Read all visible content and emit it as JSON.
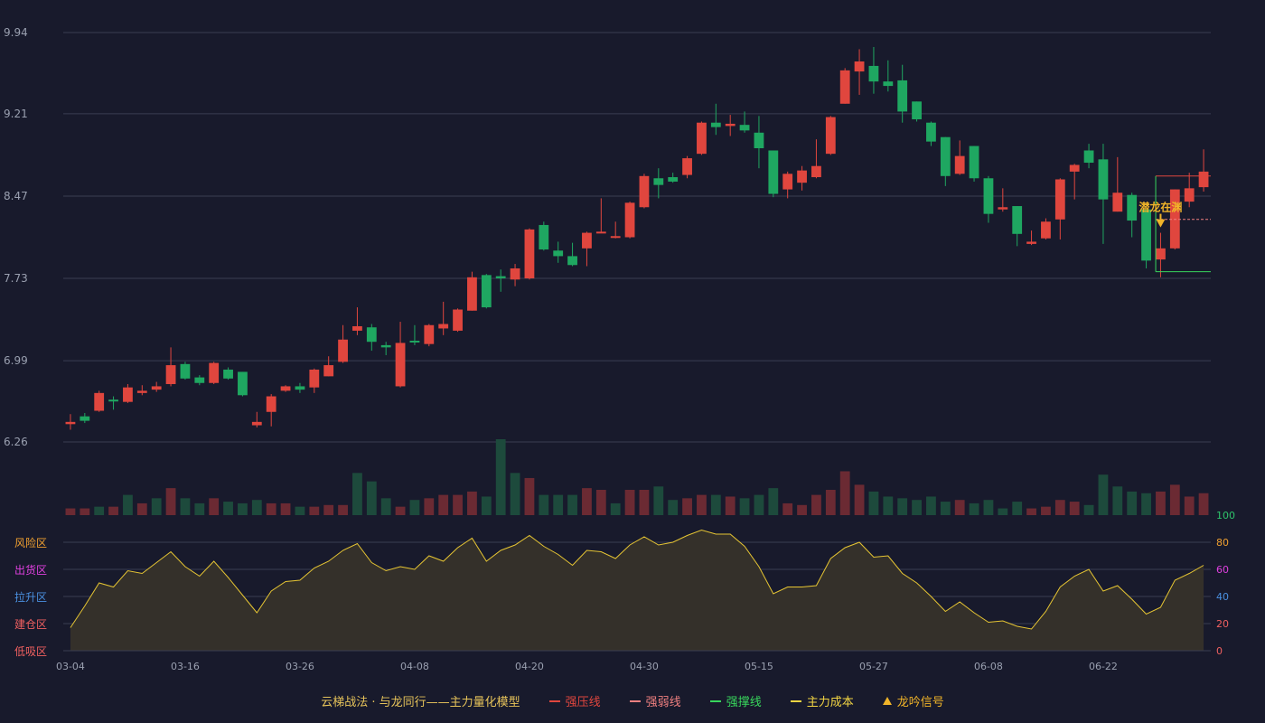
{
  "colors": {
    "background": "#181a2c",
    "up": "#e0463e",
    "down": "#1fa761",
    "vol_up": "#6b2a33",
    "vol_down": "#1d4a3c",
    "grid": "#3a3d52",
    "axis_text": "#9aa0b0",
    "osc_line": "#e6c533",
    "osc_fill": "#34302a",
    "pressure": "#e0463e",
    "weak": "#f08080",
    "support": "#38d65c",
    "cost": "#f1d443",
    "signal": "#f0b429"
  },
  "chart_data": {
    "type": "candlestick",
    "price_axis": {
      "ticks": [
        "9.94",
        "9.21",
        "8.47",
        "7.73",
        "6.99",
        "6.26"
      ],
      "range": [
        6.26,
        9.94
      ]
    },
    "x_axis": {
      "labels": [
        "03-04",
        "03-16",
        "03-26",
        "04-08",
        "04-20",
        "04-30",
        "05-15",
        "05-27",
        "06-08",
        "06-22"
      ],
      "label_indices": [
        0,
        8,
        16,
        24,
        32,
        40,
        48,
        56,
        64,
        72
      ]
    },
    "candles": [
      [
        6.42,
        6.44,
        6.51,
        6.37
      ],
      [
        6.49,
        6.45,
        6.52,
        6.43
      ],
      [
        6.54,
        6.7,
        6.72,
        6.53
      ],
      [
        6.64,
        6.63,
        6.67,
        6.55
      ],
      [
        6.62,
        6.75,
        6.78,
        6.61
      ],
      [
        6.7,
        6.72,
        6.77,
        6.68
      ],
      [
        6.73,
        6.76,
        6.8,
        6.71
      ],
      [
        6.78,
        6.95,
        7.11,
        6.76
      ],
      [
        6.96,
        6.83,
        6.98,
        6.82
      ],
      [
        6.84,
        6.79,
        6.86,
        6.77
      ],
      [
        6.79,
        6.97,
        6.98,
        6.78
      ],
      [
        6.91,
        6.83,
        6.93,
        6.82
      ],
      [
        6.89,
        6.68,
        6.89,
        6.67
      ],
      [
        6.41,
        6.44,
        6.53,
        6.39
      ],
      [
        6.53,
        6.67,
        6.69,
        6.4
      ],
      [
        6.72,
        6.76,
        6.77,
        6.71
      ],
      [
        6.76,
        6.73,
        6.79,
        6.7
      ],
      [
        6.75,
        6.91,
        6.92,
        6.7
      ],
      [
        6.85,
        6.95,
        7.03,
        6.85
      ],
      [
        6.98,
        7.18,
        7.31,
        6.97
      ],
      [
        7.26,
        7.3,
        7.47,
        7.22
      ],
      [
        7.29,
        7.16,
        7.32,
        7.08
      ],
      [
        7.13,
        7.11,
        7.16,
        7.04
      ],
      [
        6.76,
        7.15,
        7.34,
        6.75
      ],
      [
        7.17,
        7.16,
        7.31,
        7.13
      ],
      [
        7.14,
        7.31,
        7.32,
        7.12
      ],
      [
        7.28,
        7.32,
        7.52,
        7.22
      ],
      [
        7.26,
        7.45,
        7.46,
        7.25
      ],
      [
        7.44,
        7.74,
        7.79,
        7.44
      ],
      [
        7.76,
        7.47,
        7.77,
        7.46
      ],
      [
        7.75,
        7.73,
        7.81,
        7.61
      ],
      [
        7.72,
        7.82,
        7.86,
        7.66
      ],
      [
        7.73,
        8.17,
        8.18,
        7.72
      ],
      [
        8.21,
        7.99,
        8.24,
        7.98
      ],
      [
        7.98,
        7.93,
        8.06,
        7.87
      ],
      [
        7.93,
        7.85,
        8.05,
        7.84
      ],
      [
        8.0,
        8.14,
        8.15,
        7.84
      ],
      [
        8.15,
        8.15,
        8.45,
        8.14
      ],
      [
        8.11,
        8.11,
        8.24,
        8.09
      ],
      [
        8.1,
        8.41,
        8.42,
        8.09
      ],
      [
        8.37,
        8.65,
        8.67,
        8.36
      ],
      [
        8.63,
        8.57,
        8.72,
        8.45
      ],
      [
        8.64,
        8.6,
        8.68,
        8.59
      ],
      [
        8.66,
        8.81,
        8.83,
        8.63
      ],
      [
        8.85,
        9.13,
        9.14,
        8.84
      ],
      [
        9.13,
        9.09,
        9.3,
        9.02
      ],
      [
        9.1,
        9.12,
        9.2,
        9.01
      ],
      [
        9.11,
        9.06,
        9.23,
        9.04
      ],
      [
        9.04,
        8.9,
        9.19,
        8.72
      ],
      [
        8.88,
        8.49,
        8.88,
        8.46
      ],
      [
        8.53,
        8.67,
        8.69,
        8.45
      ],
      [
        8.59,
        8.7,
        8.74,
        8.52
      ],
      [
        8.64,
        8.74,
        8.98,
        8.63
      ],
      [
        8.85,
        9.18,
        9.19,
        8.84
      ],
      [
        9.3,
        9.6,
        9.62,
        9.3
      ],
      [
        9.59,
        9.68,
        9.79,
        9.38
      ],
      [
        9.64,
        9.5,
        9.81,
        9.39
      ],
      [
        9.5,
        9.46,
        9.69,
        9.41
      ],
      [
        9.51,
        9.23,
        9.65,
        9.13
      ],
      [
        9.32,
        9.16,
        9.32,
        9.14
      ],
      [
        9.13,
        8.96,
        9.14,
        8.92
      ],
      [
        9.0,
        8.65,
        9.0,
        8.56
      ],
      [
        8.67,
        8.83,
        8.97,
        8.66
      ],
      [
        8.92,
        8.63,
        8.92,
        8.6
      ],
      [
        8.63,
        8.31,
        8.65,
        8.23
      ],
      [
        8.35,
        8.37,
        8.54,
        8.33
      ],
      [
        8.38,
        8.13,
        8.38,
        8.02
      ],
      [
        8.04,
        8.06,
        8.16,
        8.03
      ],
      [
        8.09,
        8.24,
        8.27,
        8.08
      ],
      [
        8.26,
        8.62,
        8.63,
        8.08
      ],
      [
        8.69,
        8.75,
        8.76,
        8.44
      ],
      [
        8.88,
        8.77,
        8.94,
        8.72
      ],
      [
        8.8,
        8.44,
        8.94,
        8.04
      ],
      [
        8.33,
        8.5,
        8.82,
        8.33
      ],
      [
        8.48,
        8.25,
        8.5,
        8.1
      ],
      [
        8.35,
        7.89,
        8.35,
        7.82
      ],
      [
        7.9,
        8.0,
        8.14,
        7.74
      ],
      [
        8.0,
        8.53,
        8.53,
        7.99
      ],
      [
        8.42,
        8.54,
        8.68,
        8.37
      ],
      [
        8.55,
        8.69,
        8.89,
        8.51
      ]
    ],
    "volume": [
      4,
      4,
      5,
      5,
      12,
      7,
      10,
      16,
      10,
      7,
      10,
      8,
      7,
      9,
      7,
      7,
      5,
      5,
      6,
      6,
      25,
      20,
      10,
      5,
      9,
      10,
      12,
      12,
      14,
      11,
      45,
      25,
      22,
      12,
      12,
      12,
      16,
      15,
      7,
      15,
      15,
      17,
      9,
      10,
      12,
      12,
      11,
      10,
      12,
      16,
      7,
      6,
      12,
      15,
      26,
      18,
      14,
      11,
      10,
      9,
      11,
      8,
      9,
      7,
      9,
      4,
      8,
      4,
      5,
      9,
      8,
      6,
      24,
      17,
      14,
      13,
      14,
      18,
      11,
      13
    ],
    "volume_colors": [
      "up",
      "up",
      "down",
      "up",
      "down",
      "up",
      "down",
      "up",
      "down",
      "down",
      "up",
      "down",
      "down",
      "down",
      "up",
      "up",
      "down",
      "up",
      "up",
      "up",
      "down",
      "down",
      "down",
      "up",
      "down",
      "up",
      "up",
      "up",
      "up",
      "down",
      "down",
      "down",
      "up",
      "down",
      "down",
      "down",
      "up",
      "up",
      "down",
      "up",
      "up",
      "down",
      "down",
      "up",
      "up",
      "down",
      "up",
      "down",
      "down",
      "down",
      "up",
      "up",
      "up",
      "up",
      "up",
      "up",
      "down",
      "down",
      "down",
      "down",
      "down",
      "down",
      "up",
      "down",
      "down",
      "down",
      "down",
      "up",
      "up",
      "up",
      "up",
      "down",
      "down",
      "down",
      "down",
      "down",
      "up",
      "up",
      "up",
      "up"
    ],
    "oscillator": [
      17,
      33,
      50,
      47,
      59,
      57,
      65,
      73,
      62,
      55,
      66,
      54,
      41,
      28,
      44,
      51,
      52,
      61,
      66,
      74,
      79,
      65,
      59,
      62,
      60,
      70,
      66,
      76,
      83,
      66,
      74,
      78,
      85,
      77,
      71,
      63,
      74,
      73,
      68,
      78,
      84,
      78,
      80,
      85,
      89,
      86,
      86,
      77,
      62,
      42,
      47,
      47,
      48,
      68,
      76,
      80,
      69,
      70,
      57,
      50,
      40,
      29,
      36,
      28,
      21,
      22,
      18,
      16,
      29,
      47,
      55,
      60,
      44,
      48,
      38,
      27,
      32,
      52,
      57,
      63
    ],
    "osc_axis": {
      "ticks": [
        "100",
        "80",
        "60",
        "40",
        "20",
        "0"
      ],
      "tick_colors": [
        "#2ec46a",
        "#f0a030",
        "#e040e0",
        "#4a90e0",
        "#f06060",
        "#f06060"
      ]
    },
    "zones": [
      {
        "label": "风险区",
        "color": "#f0a030"
      },
      {
        "label": "出货区",
        "color": "#e040e0"
      },
      {
        "label": "拉升区",
        "color": "#4a90e0"
      },
      {
        "label": "建仓区",
        "color": "#f06060"
      },
      {
        "label": "低吸区",
        "color": "#f06060"
      }
    ],
    "signal": {
      "label": "潜龙在渊",
      "index": 76
    },
    "pressure_line": {
      "value": 8.65,
      "start_index": 76
    },
    "weak_line": {
      "value": 8.26,
      "start_index": 76
    },
    "support_line": {
      "value": 7.79,
      "start_index": 76
    }
  },
  "legend": {
    "title": "云梯战法 · 与龙同行——主力量化模型",
    "pressure": "强压线",
    "weak": "强弱线",
    "support": "强撑线",
    "cost": "主力成本",
    "signal": "龙吟信号"
  }
}
